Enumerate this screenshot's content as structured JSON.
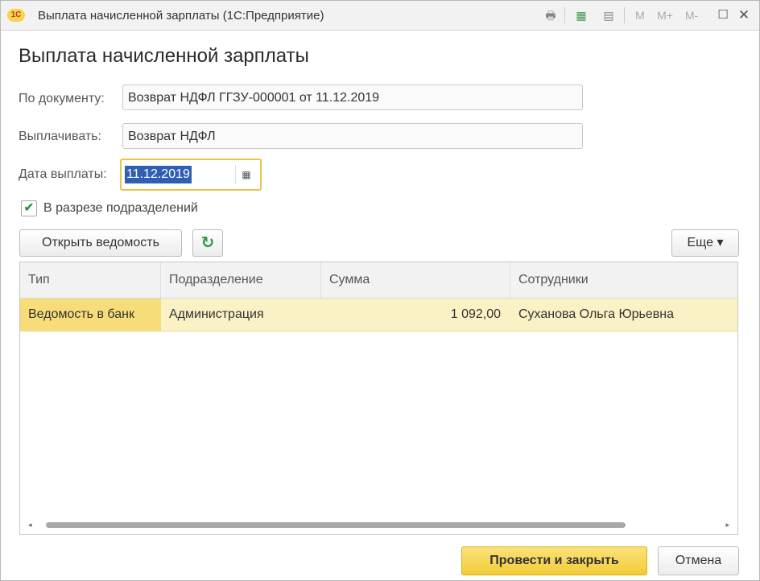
{
  "window": {
    "logo": "1С",
    "title": "Выплата начисленной зарплаты  (1С:Предприятие)",
    "toolbar_icons": [
      "printer-icon",
      "calculator-icon",
      "calendar-icon"
    ],
    "m_buttons": [
      "M",
      "M+",
      "M-"
    ]
  },
  "form": {
    "title": "Выплата начисленной зарплаты",
    "document_label": "По документу:",
    "document_value": "Возврат НДФЛ ГГЗУ-000001 от 11.12.2019",
    "pay_label": "Выплачивать:",
    "pay_value": "Возврат НДФЛ",
    "date_label": "Дата выплаты:",
    "date_value": "11.12.2019",
    "by_department_label": "В разрезе подразделений",
    "by_department_checked": true
  },
  "toolbar": {
    "open_statement": "Открыть ведомость",
    "refresh_icon": "↻",
    "more": "Еще ▾"
  },
  "table": {
    "columns": [
      "Тип",
      "Подразделение",
      "Сумма",
      "Сотрудники"
    ],
    "rows": [
      {
        "type": "Ведомость в банк",
        "department": "Администрация",
        "amount": "1 092,00",
        "employees": "Суханова Ольга Юрьевна"
      }
    ]
  },
  "footer": {
    "post_close": "Провести  и закрыть",
    "cancel": "Отмена"
  },
  "colors": {
    "accent": "#f2cc36",
    "selection": "#2f5fb3",
    "row_highlight": "#faf1c4"
  }
}
